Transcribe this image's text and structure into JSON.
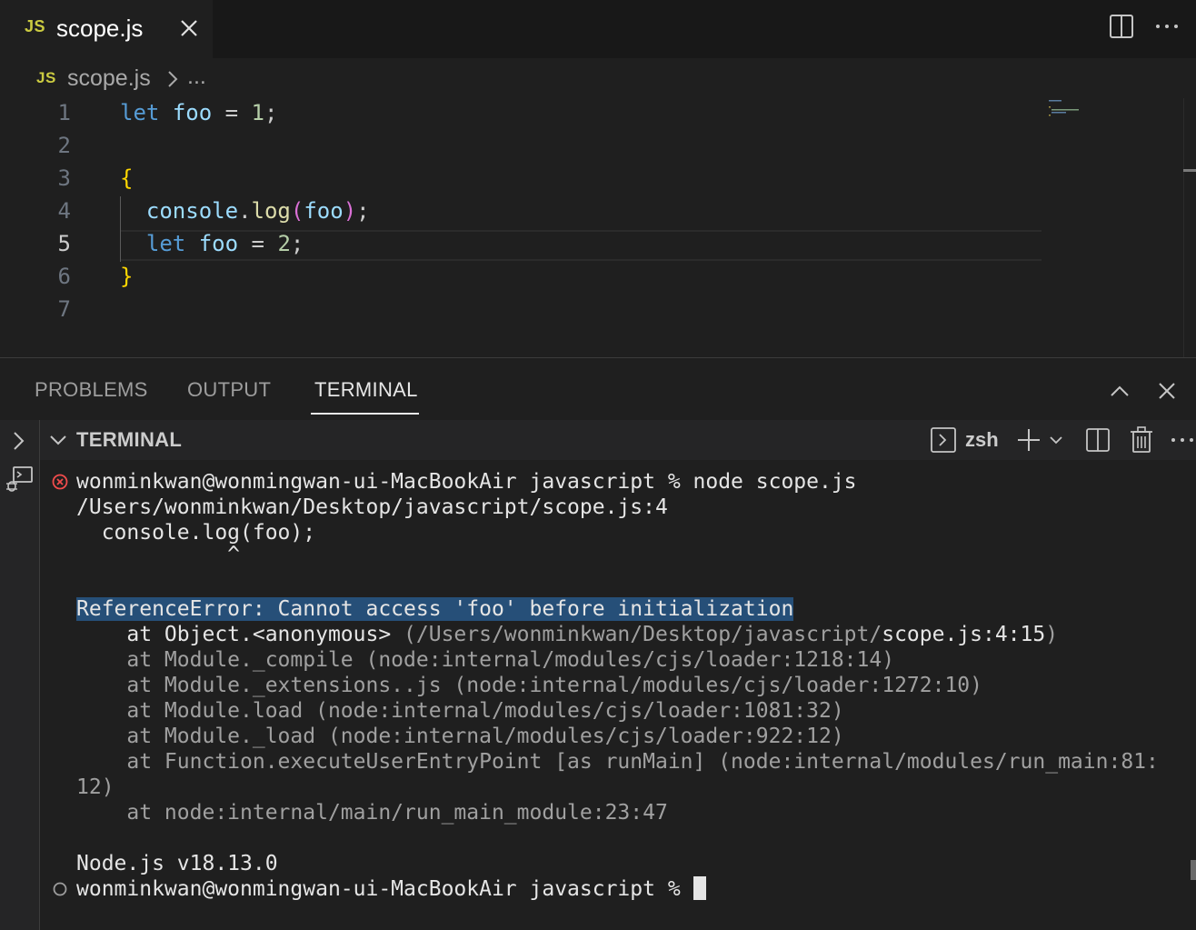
{
  "editor_tab": {
    "badge": "JS",
    "label": "scope.js"
  },
  "breadcrumb": {
    "badge": "JS",
    "file": "scope.js",
    "more": "..."
  },
  "editor": {
    "active_line": 5,
    "lines": [
      {
        "n": "1",
        "text": "let foo = 1;"
      },
      {
        "n": "2",
        "text": ""
      },
      {
        "n": "3",
        "text": "{"
      },
      {
        "n": "4",
        "text": "  console.log(foo);"
      },
      {
        "n": "5",
        "text": "  let foo = 2;"
      },
      {
        "n": "6",
        "text": "}"
      },
      {
        "n": "7",
        "text": ""
      }
    ]
  },
  "panel": {
    "tabs": [
      {
        "label": "PROBLEMS",
        "active": false
      },
      {
        "label": "OUTPUT",
        "active": false
      },
      {
        "label": "TERMINAL",
        "active": true
      }
    ]
  },
  "terminal": {
    "header_title": "TERMINAL",
    "shell": "zsh",
    "lines": {
      "cmd": "wonminkwan@wonmingwan-ui-MacBookAir javascript % node scope.js",
      "path": "/Users/wonminkwan/Desktop/javascript/scope.js:4",
      "source": "  console.log(foo);",
      "caret": "            ^",
      "error": "ReferenceError: Cannot access 'foo' before initialization",
      "at1_prefix": "    at Object.<anonymous> ",
      "at1_dim": "(/Users/wonminkwan/Desktop/javascript/",
      "at1_file": "scope.js:4:15",
      "at1_close": ")",
      "at2": "    at Module._compile (node:internal/modules/cjs/loader:1218:14)",
      "at3": "    at Module._extensions..js (node:internal/modules/cjs/loader:1272:10)",
      "at4": "    at Module.load (node:internal/modules/cjs/loader:1081:32)",
      "at5": "    at Module._load (node:internal/modules/cjs/loader:922:12)",
      "at6": "    at Function.executeUserEntryPoint [as runMain] (node:internal/modules/run_main:81:",
      "at6_wrap": "12)",
      "at7": "    at node:internal/main/run_main_module:23:47",
      "node_version": "Node.js v18.13.0",
      "prompt": "wonminkwan@wonmingwan-ui-MacBookAir javascript % "
    }
  },
  "colors": {
    "accent_error": "#f14c4c",
    "selection": "#264f78",
    "keyword": "#569cd6",
    "variable": "#9cdcfe",
    "number": "#b5cea8",
    "brace": "#ffd700",
    "js_badge": "#cbcb41"
  }
}
